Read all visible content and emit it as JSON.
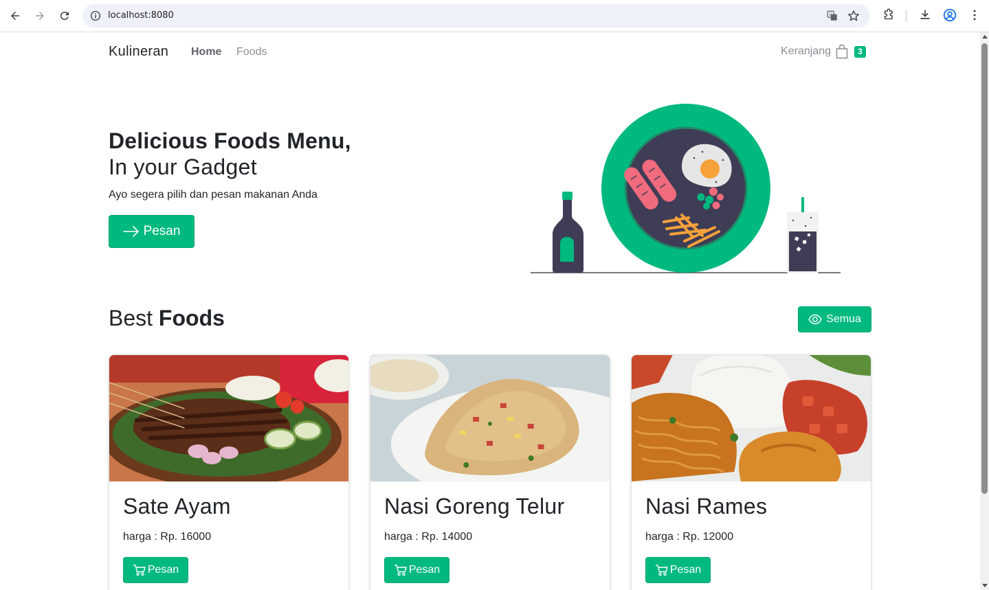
{
  "browser": {
    "url": "localhost:8080",
    "icons": [
      "back-icon",
      "forward-icon",
      "reload-icon",
      "info-icon",
      "translate-icon",
      "star-icon",
      "extensions-icon",
      "download-icon",
      "profile-icon",
      "menu-icon"
    ]
  },
  "nav": {
    "brand": "Kulineran",
    "links": [
      "Home",
      "Foods"
    ],
    "cart_label": "Keranjang",
    "cart_count": "3"
  },
  "hero": {
    "title": "Delicious Foods Menu,",
    "subtitle": "In your Gadget",
    "description": "Ayo segera pilih dan pesan makanan Anda",
    "button": "Pesan"
  },
  "best": {
    "title_prefix": "Best",
    "title_bold": "Foods",
    "all_button": "Semua"
  },
  "foods": [
    {
      "name": "Sate Ayam",
      "price": "harga : Rp. 16000",
      "button": "Pesan"
    },
    {
      "name": "Nasi Goreng Telur",
      "price": "harga : Rp. 14000",
      "button": "Pesan"
    },
    {
      "name": "Nasi Rames",
      "price": "harga : Rp. 12000",
      "button": "Pesan"
    }
  ],
  "colors": {
    "accent": "#00b97f",
    "text": "#212529",
    "muted": "#8a8f94"
  }
}
